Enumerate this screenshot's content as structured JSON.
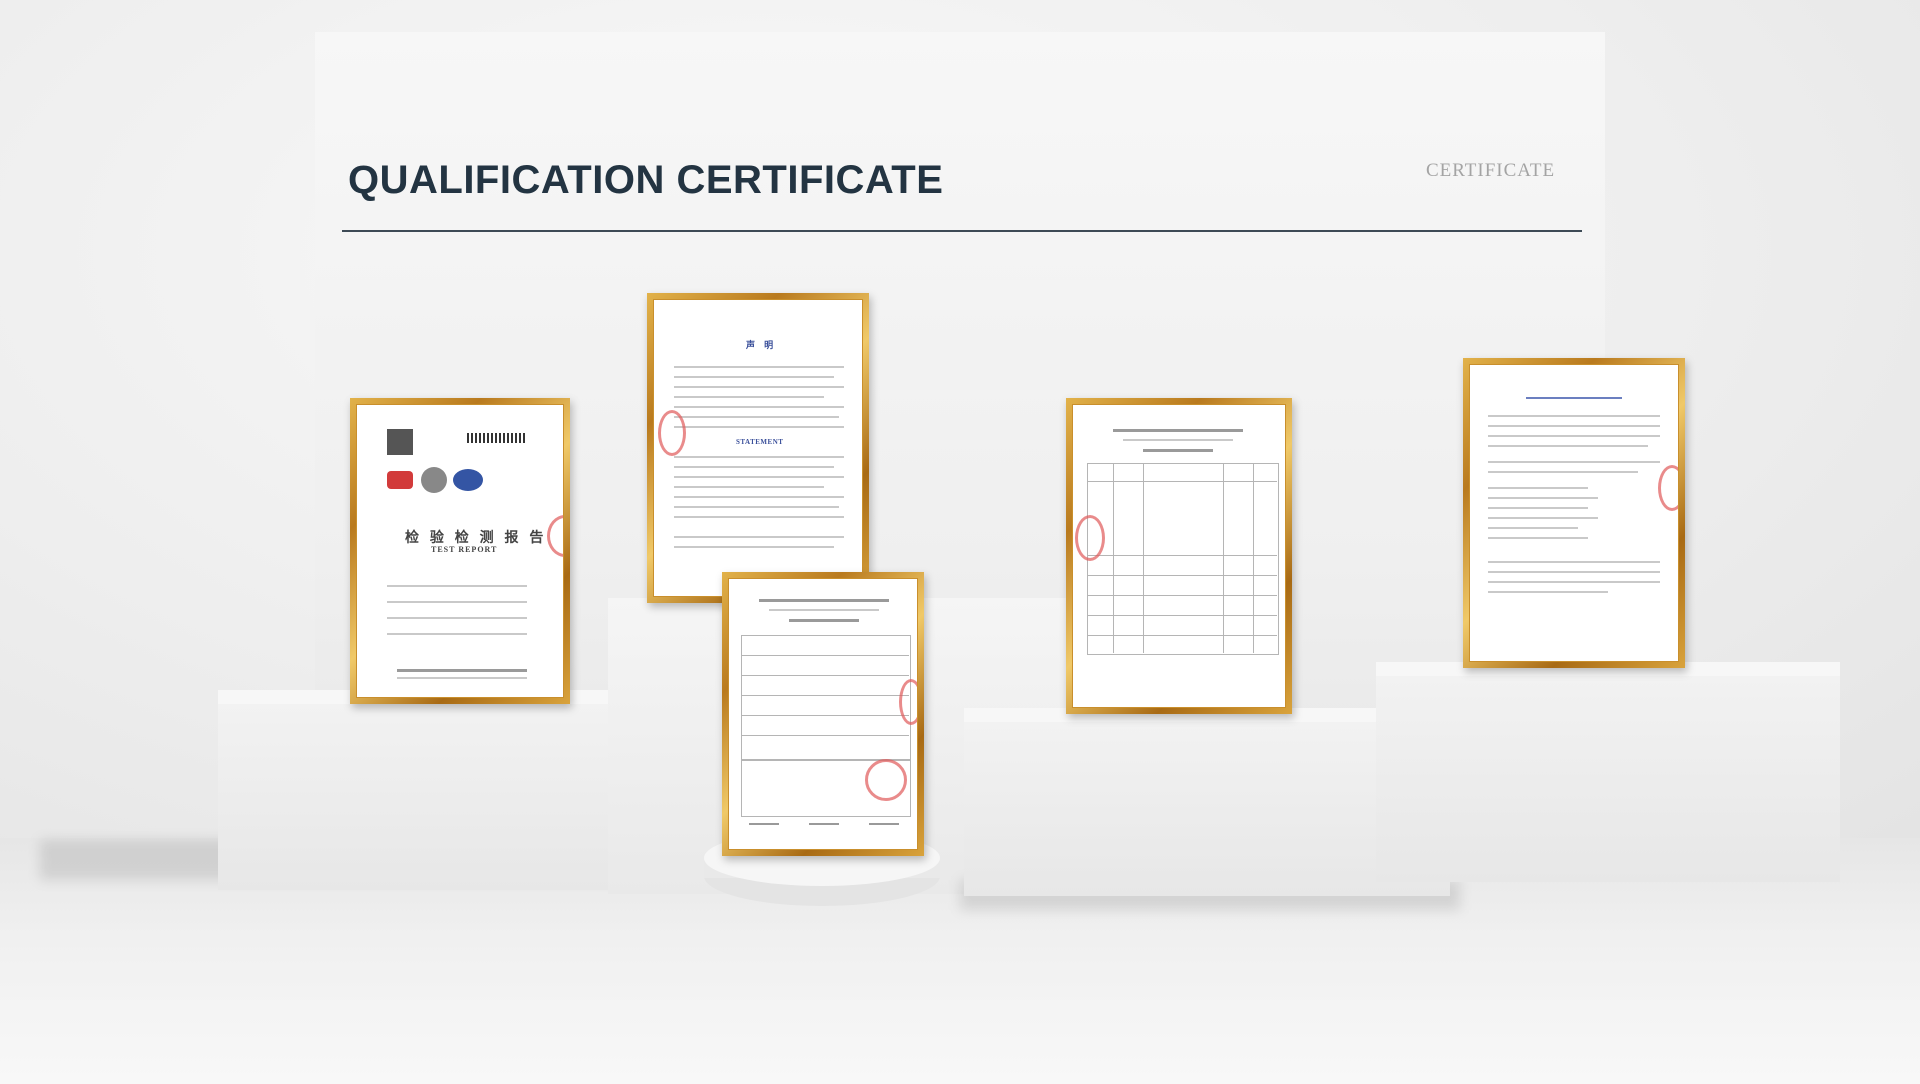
{
  "header": {
    "title": "QUALIFICATION CERTIFICATE",
    "subtitle": "CERTIFICATE"
  },
  "certificates": [
    {
      "name": "test-report-cover",
      "heading": "检 验 检 测 报 告",
      "subheading": "TEST REPORT"
    },
    {
      "name": "statement-page",
      "heading": "声 明",
      "subheading": "STATEMENT"
    },
    {
      "name": "inspection-report-table"
    },
    {
      "name": "inspection-results-table"
    },
    {
      "name": "institute-letter"
    }
  ]
}
